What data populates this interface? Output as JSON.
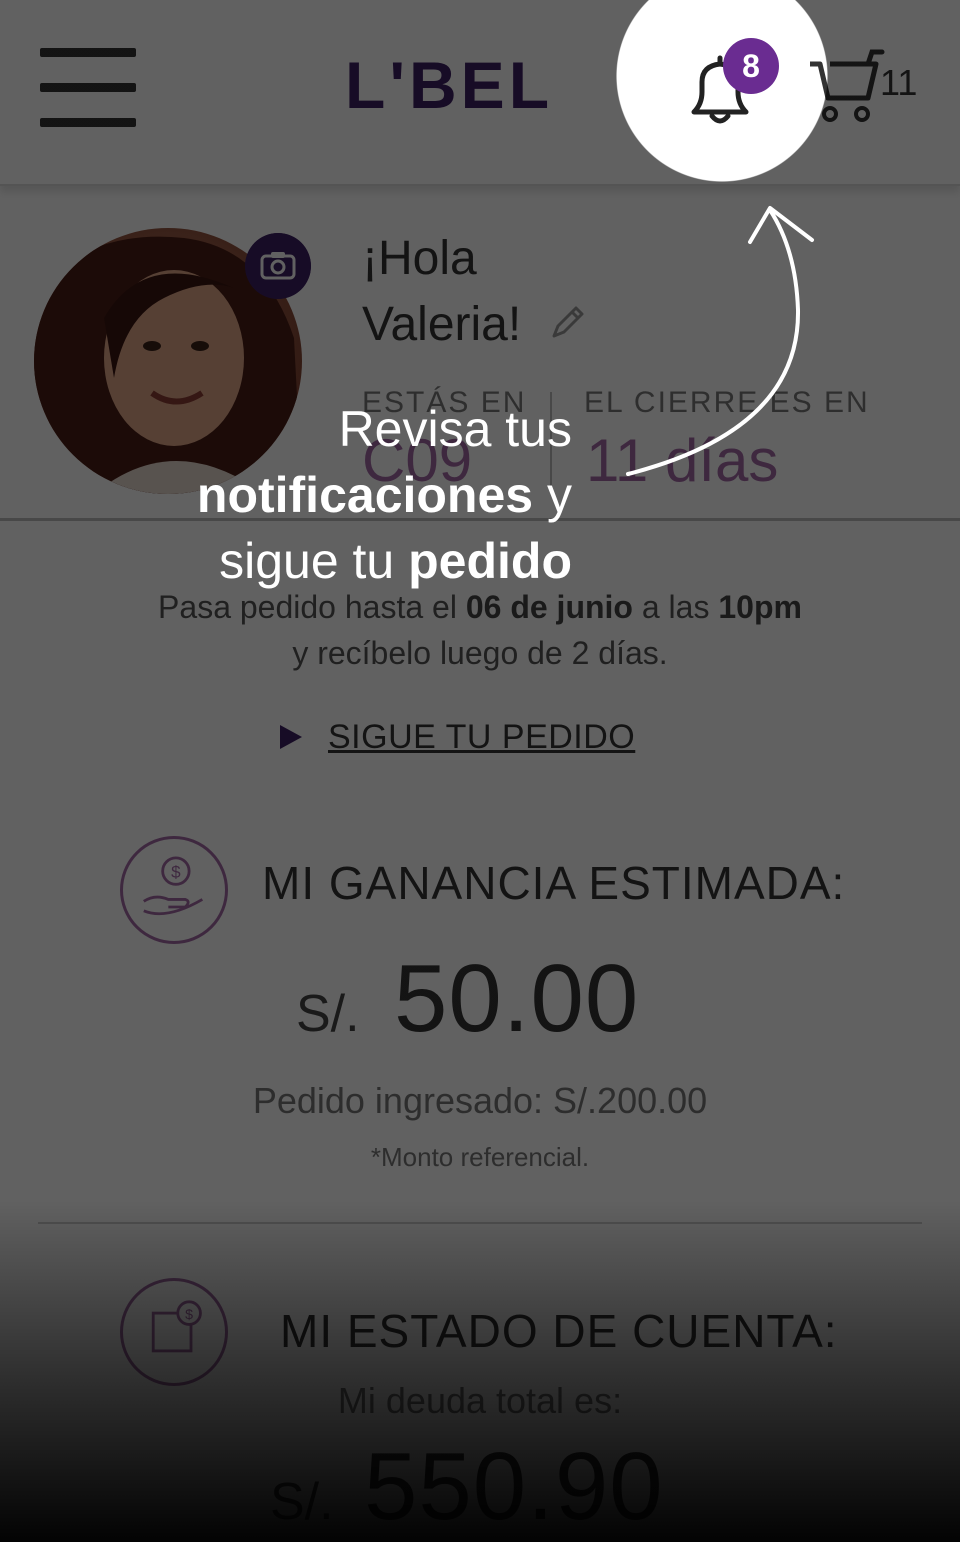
{
  "header": {
    "logo": "L'BEL",
    "notifications_count": "8",
    "cart_count": "11"
  },
  "profile": {
    "greeting_line1": "¡Hola",
    "greeting_line2": "Valeria!",
    "campaign_label": "ESTÁS EN",
    "campaign_value": "C09",
    "closing_label": "EL CIERRE ES EN",
    "closing_value": "11 días"
  },
  "order_info": {
    "line1_pre": "Pasa pedido hasta el ",
    "line1_date": "06 de junio",
    "line1_mid": " a las ",
    "line1_time": "10pm",
    "line2": "y recíbelo luego de 2 días.",
    "track_link": "SIGUE TU PEDIDO"
  },
  "earnings": {
    "title": "MI GANANCIA ESTIMADA:",
    "currency": "S/.",
    "amount": "50.00",
    "order_entered": "Pedido ingresado: S/.200.00",
    "note": "*Monto referencial."
  },
  "account": {
    "title": "MI ESTADO DE CUENTA:",
    "debt_label": "Mi deuda total es:",
    "currency": "S/.",
    "amount": "550.90"
  },
  "coachmark": {
    "line1": "Revisa tus",
    "line2_bold": "notificaciones",
    "line2_rest": " y",
    "line3_rest": "sigue tu ",
    "line3_bold": "pedido"
  },
  "colors": {
    "brand_purple": "#3d1f63",
    "badge_purple": "#6a2c91",
    "accent_mauve": "#a36aa6"
  }
}
